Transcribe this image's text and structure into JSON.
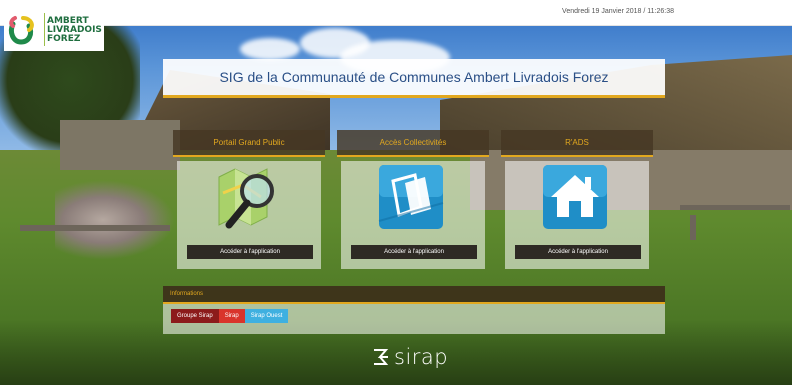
{
  "header": {
    "datetime": "Vendredi 19 Janvier 2018 / 11:26:38",
    "logo_lines": [
      "AMBERT",
      "LIVRADOIS",
      "FOREZ"
    ]
  },
  "title": "SIG de la Communauté de Communes Ambert Livradois Forez",
  "apps": [
    {
      "title": "Portail Grand Public",
      "icon": "map-magnifier-icon",
      "button": "Accéder à l'application"
    },
    {
      "title": "Accès Collectivités",
      "icon": "documents-icon",
      "button": "Accéder à l'application"
    },
    {
      "title": "R'ADS",
      "icon": "house-icon",
      "button": "Accéder à l'application"
    }
  ],
  "info": {
    "label": "Informations",
    "tags": [
      {
        "label": "Groupe Sirap",
        "color": "#8c1b1b"
      },
      {
        "label": "Sirap",
        "color": "#d9342b"
      },
      {
        "label": "Sirap Ouest",
        "color": "#3fb0e0"
      }
    ]
  },
  "footer": {
    "brand": "sirap"
  },
  "colors": {
    "accent": "#e2a81f",
    "title": "#2a4f86",
    "logo": "#1f6e3f"
  }
}
